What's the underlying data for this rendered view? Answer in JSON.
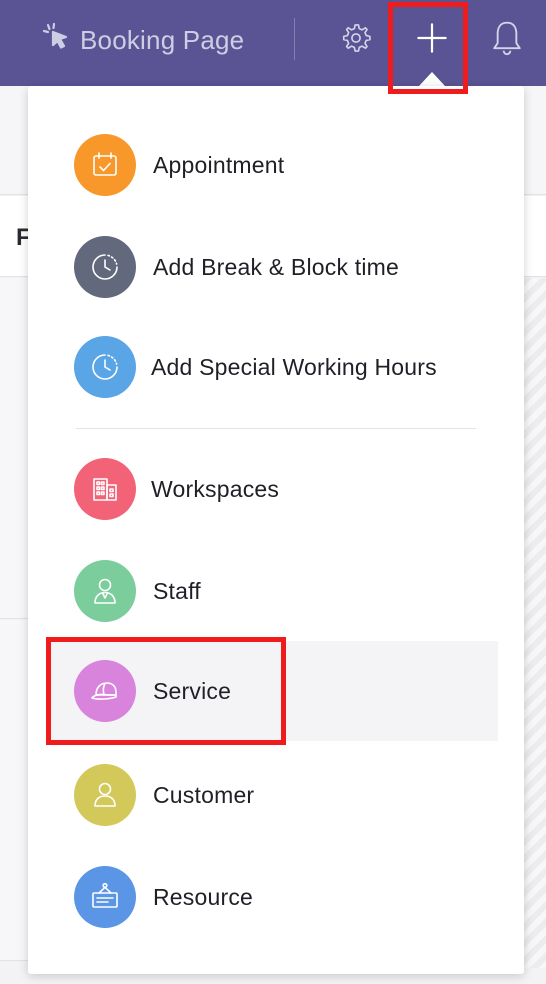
{
  "header": {
    "booking_page_label": "Booking Page",
    "icons": {
      "booking": "cursor-click-icon",
      "settings": "gear-icon",
      "add": "plus-icon",
      "notifications": "bell-icon"
    },
    "background_color": "#5a5494"
  },
  "background": {
    "partial_letter": "F"
  },
  "add_menu": {
    "items": [
      {
        "label": "Appointment",
        "icon": "calendar-check-icon",
        "color": "#f8982a"
      },
      {
        "label": "Add Break & Block time",
        "icon": "clock-icon",
        "color": "#63697c"
      },
      {
        "label": "Add Special Working Hours",
        "icon": "clock-icon",
        "color": "#5aa5e6"
      },
      {
        "label": "Workspaces",
        "icon": "building-icon",
        "color": "#f26378"
      },
      {
        "label": "Staff",
        "icon": "person-pin-icon",
        "color": "#7ccd9c"
      },
      {
        "label": "Service",
        "icon": "cap-icon",
        "color": "#d883dc"
      },
      {
        "label": "Customer",
        "icon": "person-icon",
        "color": "#d3c95a"
      },
      {
        "label": "Resource",
        "icon": "signboard-icon",
        "color": "#5b95e6"
      }
    ],
    "hovered_item": "Service"
  },
  "annotations": {
    "highlight_color": "#ee1c1c",
    "highlighted": [
      "Add",
      "Service"
    ]
  }
}
